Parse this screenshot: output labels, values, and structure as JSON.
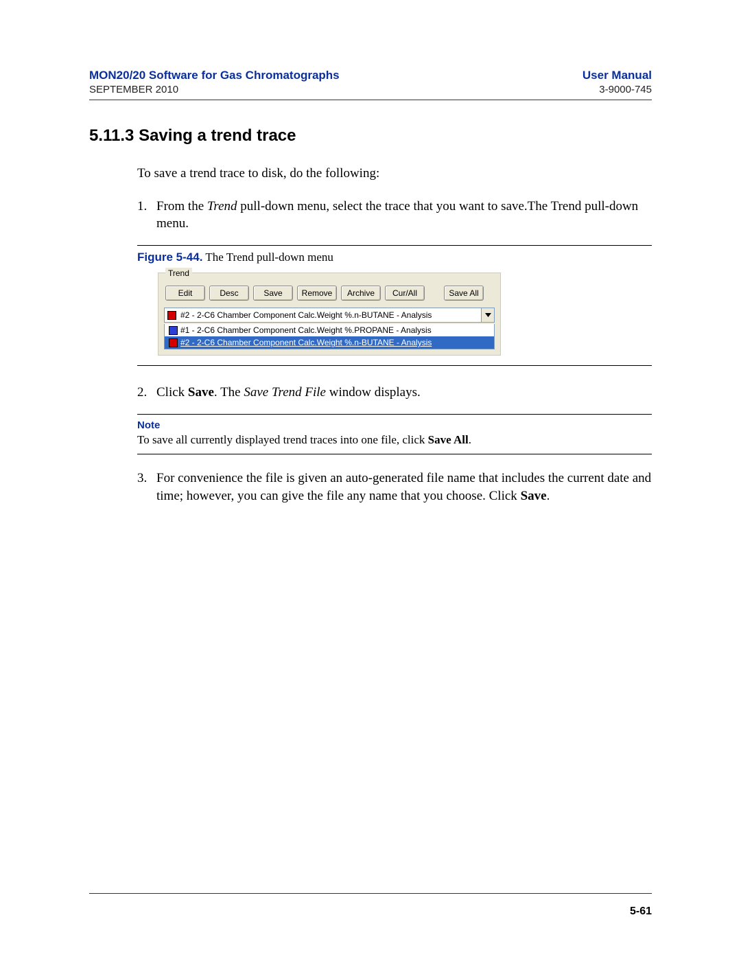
{
  "header": {
    "title_left": "MON20/20 Software for Gas Chromatographs",
    "title_right": "User Manual",
    "date": "SEPTEMBER 2010",
    "docnum": "3-9000-745"
  },
  "section": {
    "number": "5.11.3",
    "title": "Saving a trend trace"
  },
  "intro": "To save a trend trace to disk, do the following:",
  "steps": {
    "s1_pre": "From the ",
    "s1_em": "Trend",
    "s1_post": " pull-down menu, select the trace that you want to save.The Trend pull-down menu.",
    "s2_pre": "Click ",
    "s2_b": "Save",
    "s2_mid": ".  The ",
    "s2_em": "Save Trend File",
    "s2_post": " window displays.",
    "s3_pre": "For convenience the file is given an auto-generated file name that includes the current date and time; however, you can give the file any name that you choose.  Click ",
    "s3_b": "Save",
    "s3_post": "."
  },
  "figure": {
    "label": "Figure 5-44.",
    "caption": "The Trend pull-down menu"
  },
  "trend_panel": {
    "legend": "Trend",
    "buttons": [
      "Edit",
      "Desc",
      "Save",
      "Remove",
      "Archive",
      "Cur/All",
      "Save All"
    ],
    "selected_text": "#2 - 2-C6 Chamber Component Calc.Weight %.n-BUTANE - Analysis",
    "selected_color": "#d40000",
    "options": [
      {
        "color": "#2b3fd6",
        "text": "#1 - 2-C6 Chamber Component Calc.Weight %.PROPANE - Analysis",
        "selected": false
      },
      {
        "color": "#d40000",
        "text": "#2 - 2-C6 Chamber Component Calc.Weight %.n-BUTANE - Analysis",
        "selected": true
      }
    ]
  },
  "note": {
    "label": "Note",
    "text_pre": "To save all currently displayed trend traces into one file, click ",
    "text_b": "Save All",
    "text_post": "."
  },
  "footer": {
    "page": "5-61"
  }
}
